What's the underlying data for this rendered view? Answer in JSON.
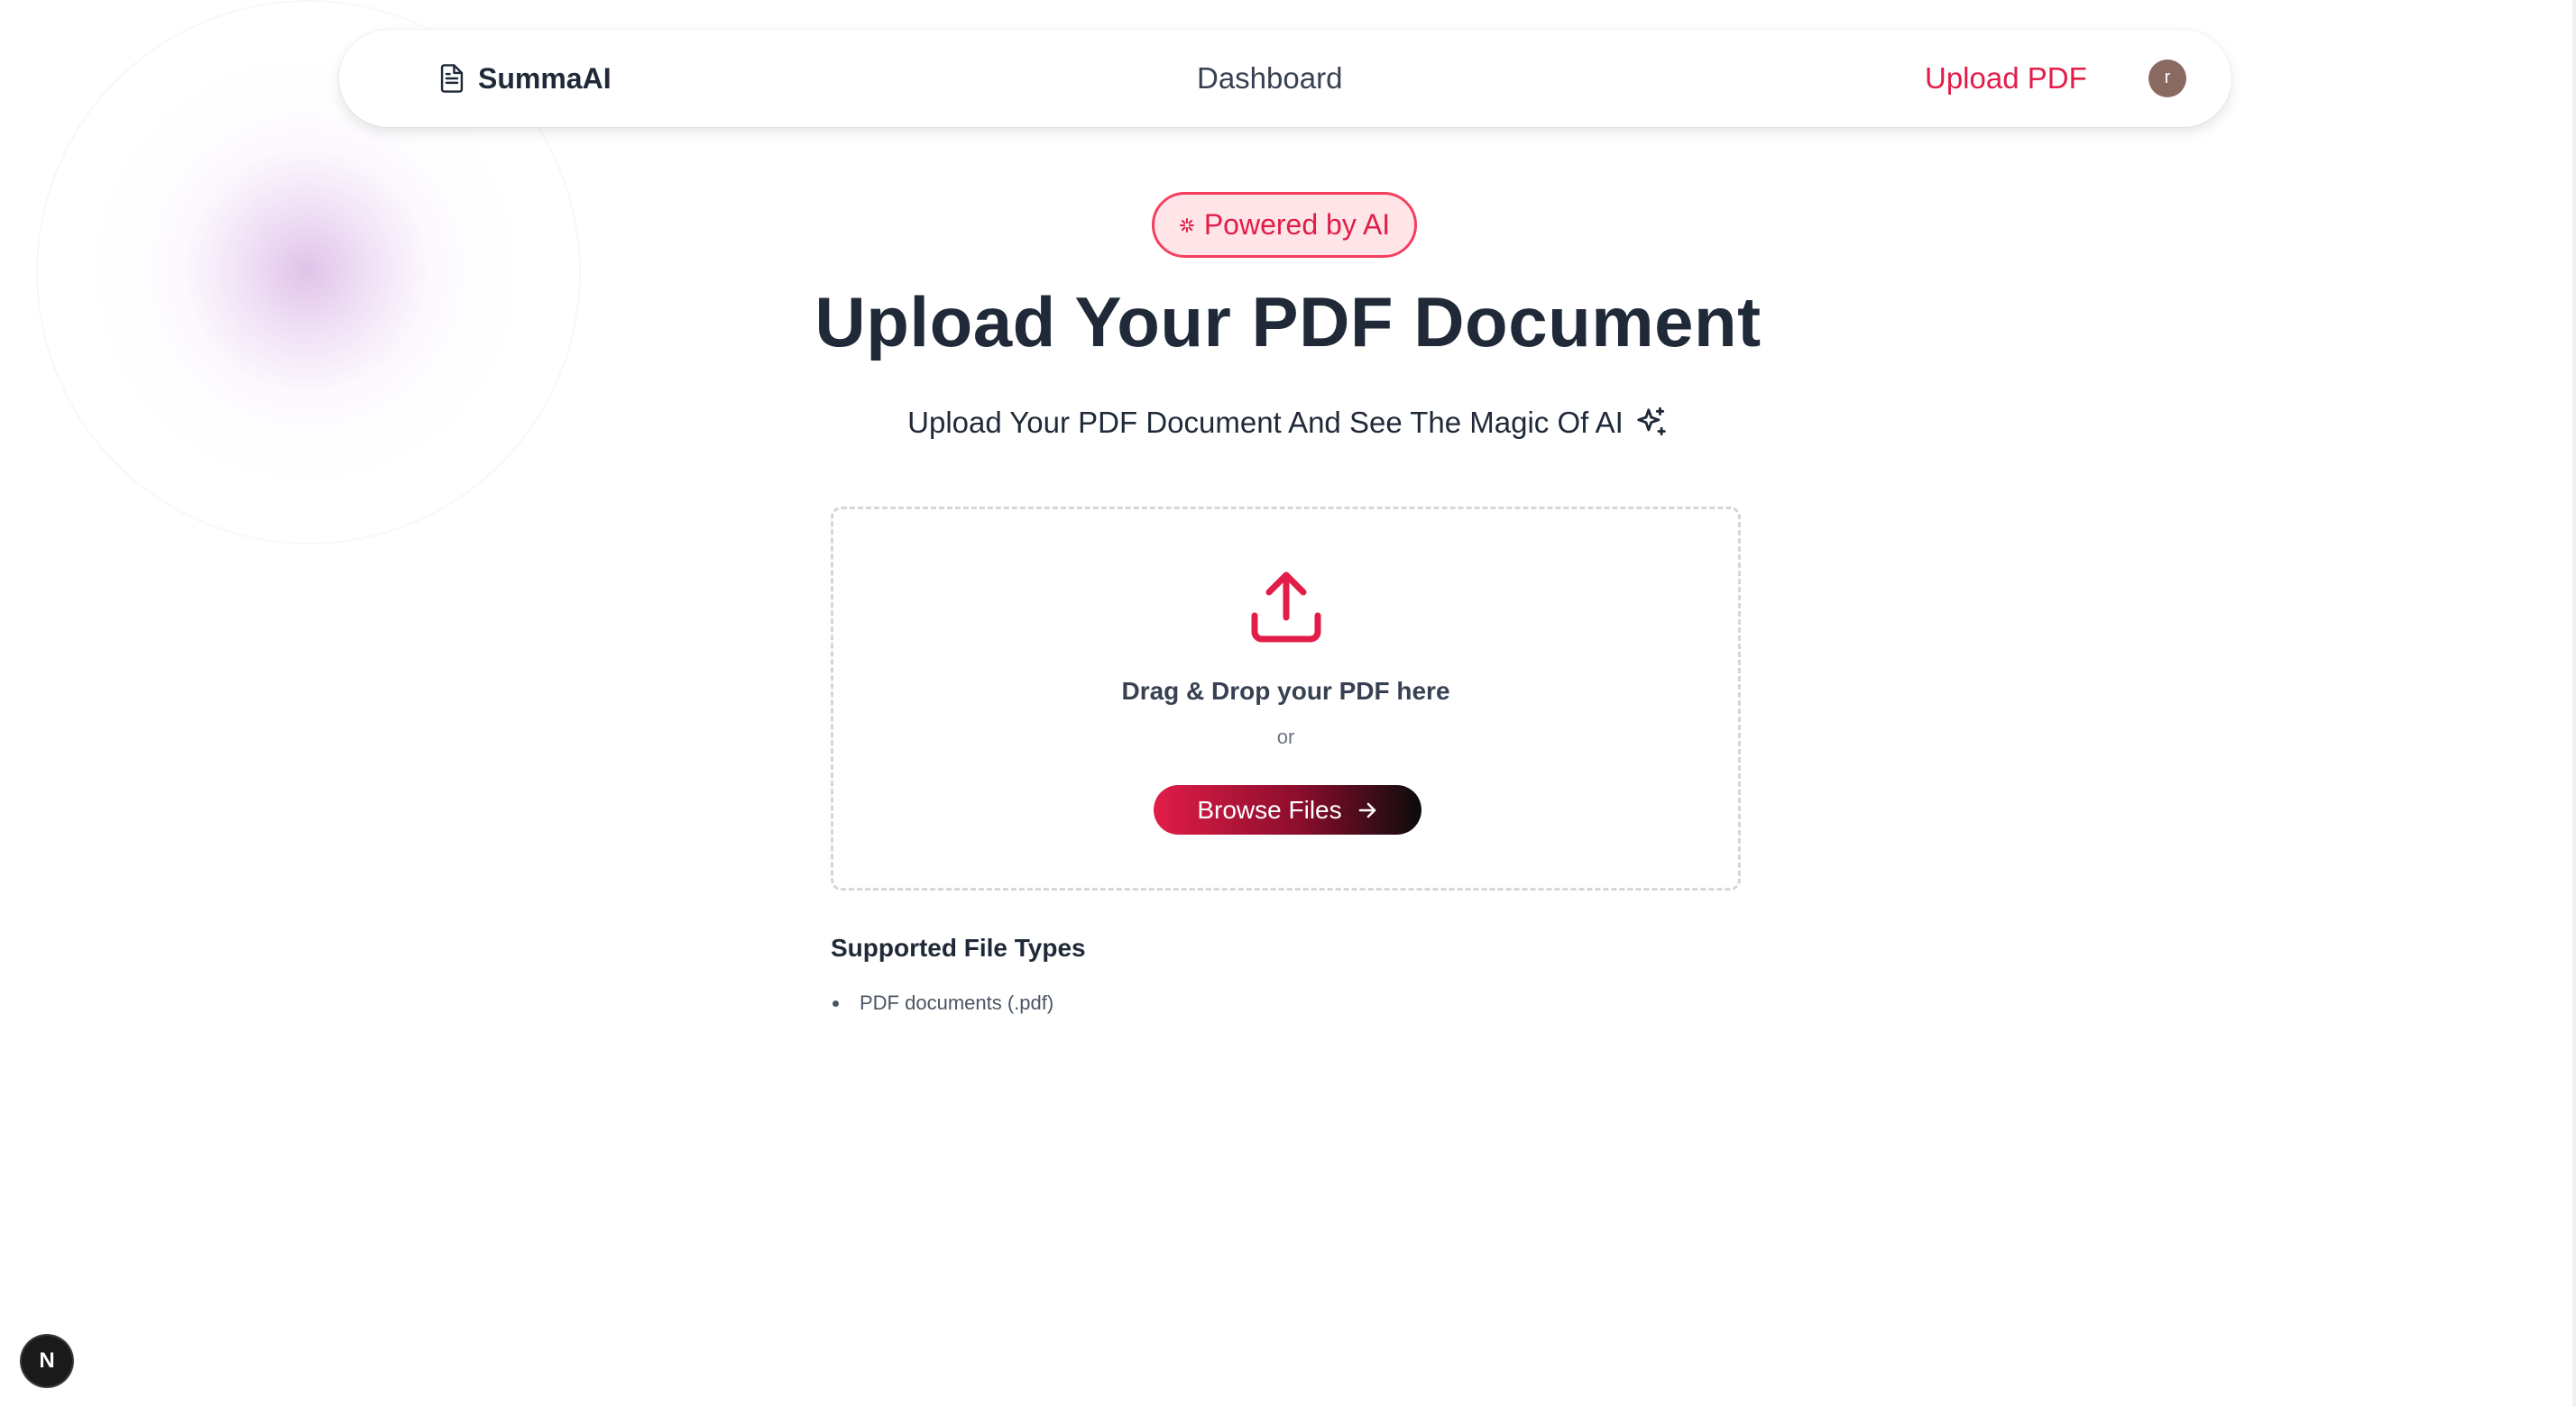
{
  "header": {
    "brand_name": "SummaAI",
    "brand_icon": "document-icon",
    "nav_dashboard": "Dashboard",
    "nav_upload": "Upload PDF",
    "avatar_initial": "r"
  },
  "hero": {
    "badge_label": "Powered by AI",
    "badge_icon": "sparkle-icon",
    "title": "Upload Your PDF Document",
    "subtitle": "Upload Your PDF Document And See The Magic Of AI",
    "subtitle_icon": "sparkles-icon"
  },
  "dropzone": {
    "icon": "upload-icon",
    "drag_text": "Drag & Drop your PDF here",
    "or_text": "or",
    "browse_label": "Browse Files",
    "browse_icon": "arrow-right-icon"
  },
  "supported": {
    "title": "Supported File Types",
    "items": [
      "PDF documents (.pdf)"
    ]
  },
  "dev_badge": {
    "label": "N"
  },
  "colors": {
    "accent": "#e11d48",
    "badge_bg": "#ffe4e8",
    "text_dark": "#1f2937",
    "avatar_bg": "#8a6a60"
  }
}
